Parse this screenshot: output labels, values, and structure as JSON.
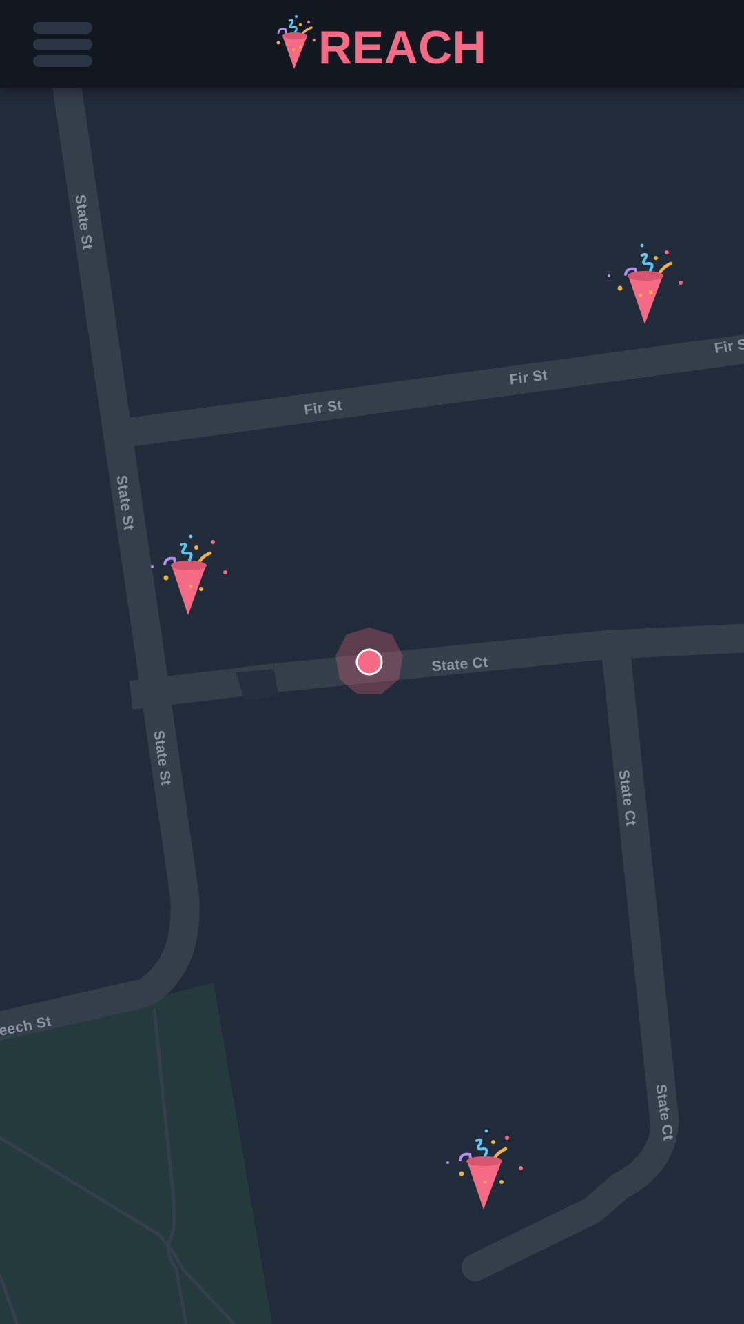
{
  "app": {
    "name": "REACH",
    "brand_color": "#f56b85"
  },
  "header": {
    "menu_icon": "hamburger-menu-icon",
    "logo_icon": "party-popper-icon",
    "title": "REACH",
    "background": "#121820"
  },
  "map": {
    "theme": "dark",
    "background": "#222b39",
    "road_color": "#353e4b",
    "park_color": "#243a3d",
    "street_labels": {
      "state_st_1": "State St",
      "state_st_2": "State St",
      "state_st_3": "State St",
      "fir_st_1": "Fir St",
      "fir_st_2": "Fir St",
      "fir_st_3": "Fir S",
      "state_ct_1": "State Ct",
      "state_ct_2": "State Ct",
      "state_ct_3": "State Ct",
      "beech_st": "eech St"
    },
    "markers": [
      {
        "icon": "party-popper-icon",
        "kind": "event"
      },
      {
        "icon": "party-popper-icon",
        "kind": "event"
      },
      {
        "icon": "party-popper-icon",
        "kind": "event"
      }
    ],
    "user_location": {
      "icon": "current-location-dot-icon",
      "color": "#f56b85"
    }
  }
}
